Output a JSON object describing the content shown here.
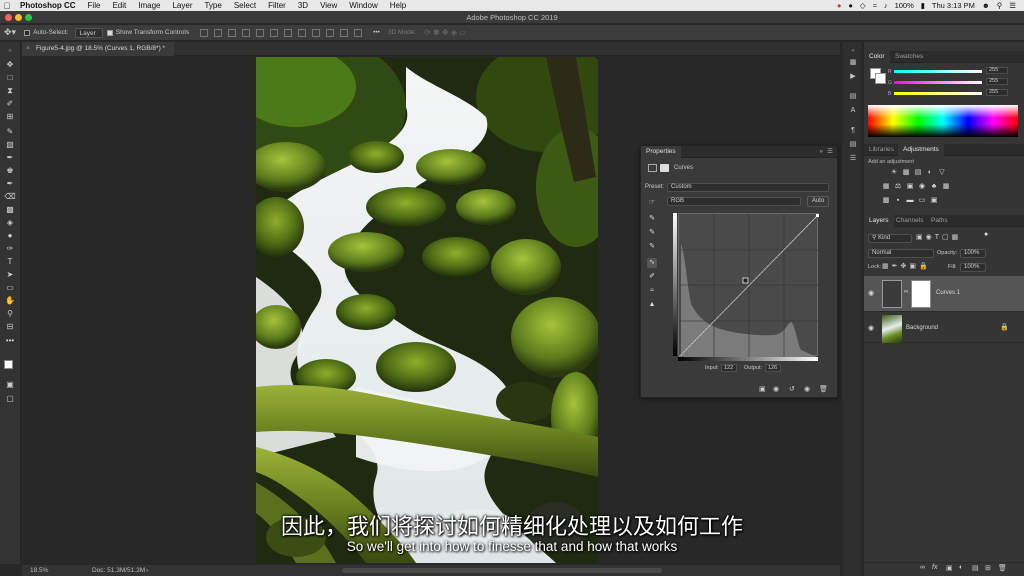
{
  "menubar": {
    "apple": "",
    "items": [
      "Photoshop CC",
      "File",
      "Edit",
      "Image",
      "Layer",
      "Type",
      "Select",
      "Filter",
      "3D",
      "View",
      "Window",
      "Help"
    ],
    "battery": "100%",
    "clock": "Thu 3:13 PM"
  },
  "window": {
    "title": "Adobe Photoshop CC 2019"
  },
  "options": {
    "auto_select_label": "Auto-Select:",
    "auto_select_target": "Layer",
    "show_transform_label": "Show Transform Controls",
    "mode_3d_label": "3D Mode:"
  },
  "document": {
    "tab_label": "Figure5-4.jpg @ 18.5% (Curves 1, RGB/8*) *",
    "zoom": "18.5%",
    "doc_size": "Doc: 51.3M/51.3M"
  },
  "properties": {
    "tab": "Properties",
    "adjustment_name": "Curves",
    "preset_label": "Preset:",
    "preset_value": "Custom",
    "channel_value": "RGB",
    "auto_label": "Auto",
    "input_label": "Input:",
    "input_value": "122",
    "output_label": "Output:",
    "output_value": "126"
  },
  "color_panel": {
    "tabs": [
      "Color",
      "Swatches"
    ],
    "r_value": "255",
    "g_value": "255",
    "b_value": "255",
    "r_label": "R",
    "g_label": "G",
    "b_label": "B"
  },
  "adjustments_panel": {
    "tabs": [
      "Libraries",
      "Adjustments"
    ],
    "add_label": "Add an adjustment"
  },
  "layers_panel": {
    "tabs": [
      "Layers",
      "Channels",
      "Paths"
    ],
    "kind_label": "Kind",
    "blend_mode": "Normal",
    "opacity_label": "Opacity:",
    "opacity_value": "100%",
    "lock_label": "Lock:",
    "fill_label": "Fill:",
    "fill_value": "100%",
    "layers": [
      {
        "name": "Curves 1"
      },
      {
        "name": "Background"
      }
    ]
  },
  "subtitles": {
    "chinese": "因此，我们将探讨如何精细化处理以及如何工作",
    "english": "So we'll get into how to finesse that and how that works"
  },
  "colors": {
    "app_bg": "#282828",
    "panel_bg": "#353535",
    "menubar_bg": "#e8e8e8",
    "accent_red": "#ff5f57",
    "accent_yellow": "#febc2e",
    "accent_green": "#28c840"
  }
}
